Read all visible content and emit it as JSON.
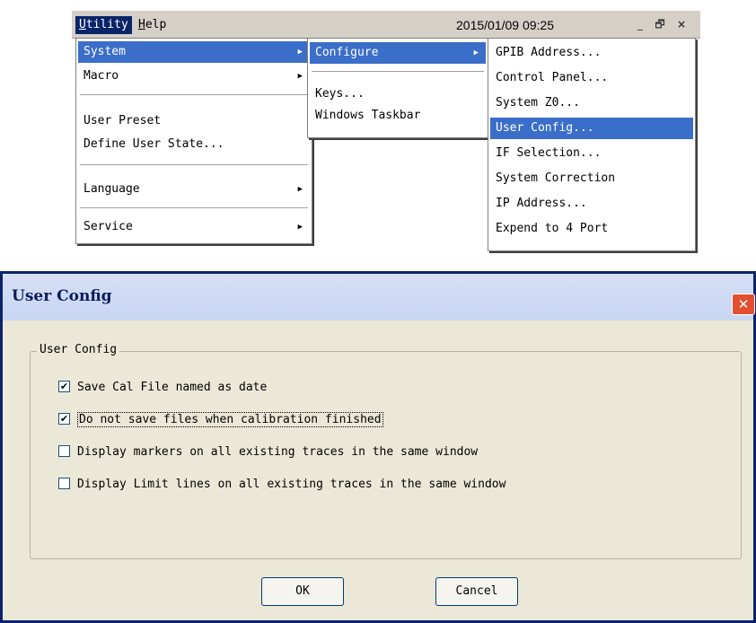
{
  "menubar": {
    "items": [
      {
        "label": "Utility",
        "active": true
      },
      {
        "label": "Help",
        "active": false
      }
    ],
    "datetime": "2015/01/09 09:25",
    "window_controls": {
      "minimize": "_",
      "restore": "🗗",
      "close": "×"
    }
  },
  "utility_menu": {
    "items": [
      {
        "label": "System",
        "has_submenu": true,
        "selected": true
      },
      {
        "label": "Macro",
        "has_submenu": true
      },
      {
        "label": "User Preset"
      },
      {
        "label": "Define User State..."
      },
      {
        "label": "Language",
        "has_submenu": true
      },
      {
        "label": "Service",
        "has_submenu": true
      }
    ]
  },
  "system_menu": {
    "items": [
      {
        "label": "Configure",
        "has_submenu": true,
        "selected": true
      },
      {
        "label": "Keys..."
      },
      {
        "label": "Windows Taskbar"
      }
    ]
  },
  "configure_menu": {
    "items": [
      {
        "label": "GPIB Address..."
      },
      {
        "label": "Control Panel..."
      },
      {
        "label": "System Z0..."
      },
      {
        "label": "User Config...",
        "selected": true
      },
      {
        "label": "IF Selection..."
      },
      {
        "label": "System Correction"
      },
      {
        "label": "IP Address..."
      },
      {
        "label": "Expend to 4 Port"
      }
    ]
  },
  "dialog": {
    "title": "User Config",
    "close_glyph": "✕",
    "group_label": "User Config",
    "options": [
      {
        "label": "Save Cal File named as date",
        "checked": true
      },
      {
        "label": "Do not save files when calibration finished",
        "checked": true
      },
      {
        "label": "Display markers on all existing traces in the same window",
        "checked": false
      },
      {
        "label": "Display Limit lines on all existing traces in the same window",
        "checked": false
      }
    ],
    "ok_label": "OK",
    "cancel_label": "Cancel"
  },
  "colors": {
    "menu_highlight": "#3a6ec9",
    "menubar_active": "#0a246a",
    "dialog_bg": "#ebe8d8",
    "close_button": "#e24f2e"
  }
}
